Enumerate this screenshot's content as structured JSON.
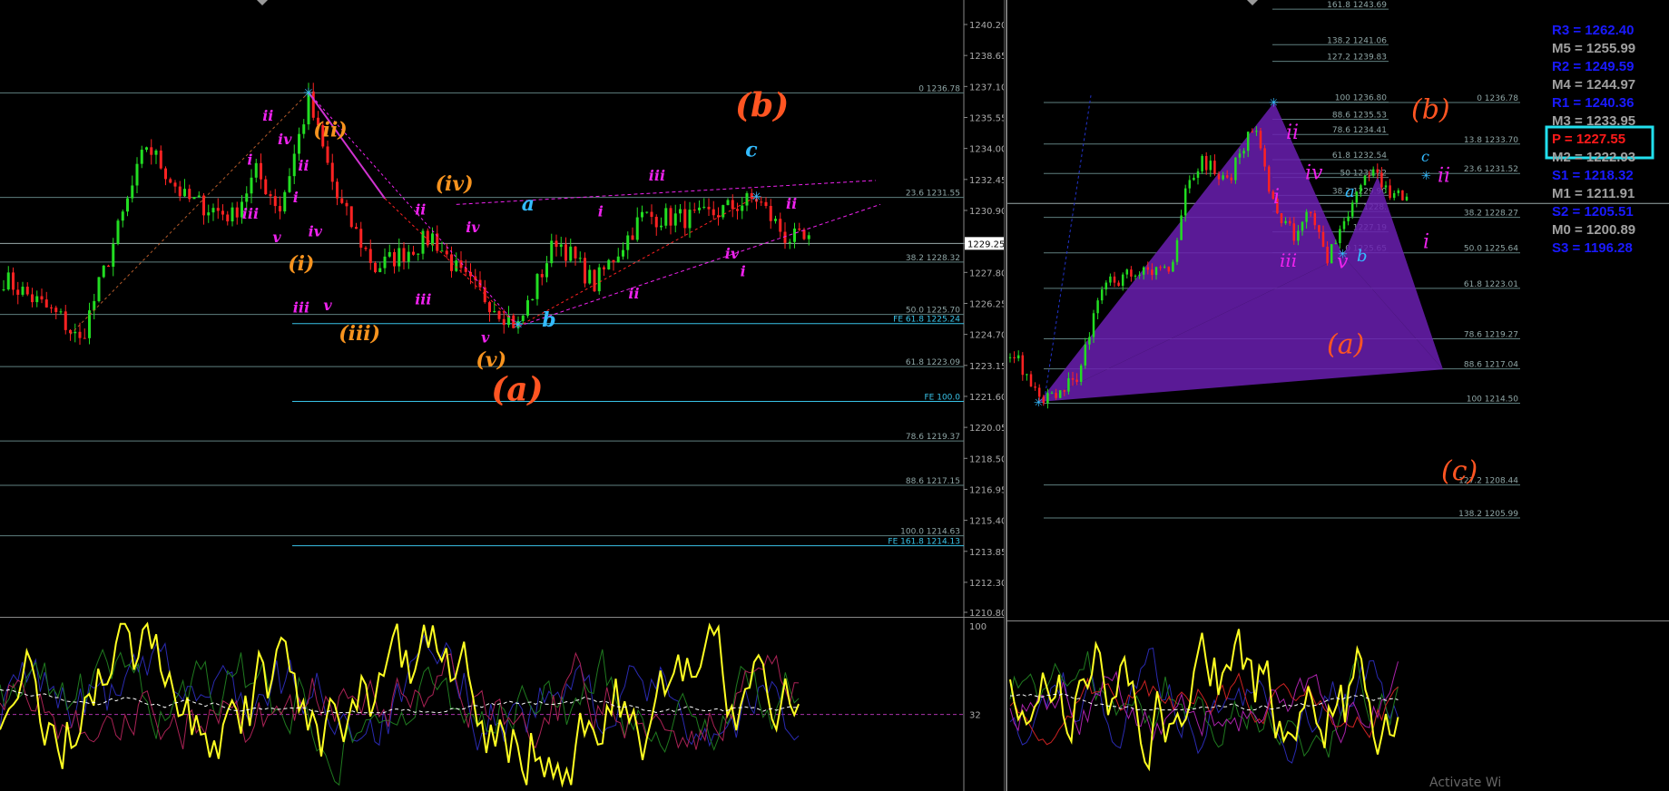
{
  "colors": {
    "bull": "#22dd22",
    "bear": "#ff2222",
    "fib": "#5f7f7f",
    "fe": "#39c3e8",
    "magenta": "#ee22ee",
    "orange": "#f7931e",
    "orange_red": "#ff5522",
    "cyan": "#33bbff",
    "yellow": "#ffff22",
    "purple_fill": "#6a1fb0",
    "wave_text": "#ff55ee"
  },
  "chart_data": [
    {
      "type": "candlestick",
      "panel": "left-main",
      "ylim": [
        1210.0,
        1241.0
      ],
      "ticks": [
        "1240.20",
        "1238.65",
        "1237.10",
        "1235.55",
        "1234.00",
        "1232.45",
        "1230.90",
        "1229.25",
        "1227.80",
        "1226.25",
        "1224.70",
        "1223.15",
        "1221.60",
        "1220.05",
        "1218.50",
        "1216.95",
        "1215.40",
        "1213.85",
        "1212.30",
        "1210.80"
      ],
      "current_price": "1229.25",
      "fib_levels": [
        {
          "label": "0 1236.78",
          "y": 1236.78
        },
        {
          "label": "23.6 1231.55",
          "y": 1231.55
        },
        {
          "label": "38.2 1228.32",
          "y": 1228.32
        },
        {
          "label": "50.0 1225.70",
          "y": 1225.7
        },
        {
          "label": "61.8 1223.09",
          "y": 1223.09
        },
        {
          "label": "78.6 1219.37",
          "y": 1219.37
        },
        {
          "label": "88.6 1217.15",
          "y": 1217.15
        },
        {
          "label": "100.0 1214.63",
          "y": 1214.63
        }
      ],
      "fe_levels": [
        {
          "label": "FE 61.8 1225.24",
          "y": 1225.24
        },
        {
          "label": "FE 100.0",
          "y": 1221.35
        },
        {
          "label": "FE 161.8 1214.13",
          "y": 1214.13
        }
      ],
      "waves": [
        {
          "t": "(b)",
          "x": 0.0,
          "y": 1235.6,
          "c": "orange_red",
          "s": 36
        },
        {
          "t": "(a)",
          "x": -0.48,
          "y": 1221.4,
          "c": "orange_red",
          "s": 36
        },
        {
          "t": "(ii)",
          "x": -0.83,
          "y": 1234.6,
          "c": "orange",
          "s": 22
        },
        {
          "t": "(iv)",
          "x": -0.59,
          "y": 1231.9,
          "c": "orange",
          "s": 22
        },
        {
          "t": "(i)",
          "x": -0.88,
          "y": 1227.9,
          "c": "orange",
          "s": 22
        },
        {
          "t": "(iii)",
          "x": -0.78,
          "y": 1224.4,
          "c": "orange",
          "s": 22
        },
        {
          "t": "(v)",
          "x": -0.51,
          "y": 1223.1,
          "c": "orange",
          "s": 22
        },
        {
          "t": "a",
          "x": -0.42,
          "y": 1230.9,
          "c": "cyan",
          "s": 22
        },
        {
          "t": "b",
          "x": -0.38,
          "y": 1225.1,
          "c": "cyan",
          "s": 22
        },
        {
          "t": "c",
          "x": 0.02,
          "y": 1233.6,
          "c": "cyan",
          "s": 22
        },
        {
          "t": "ii",
          "x": -0.93,
          "y": 1235.4,
          "c": "magenta",
          "s": 16
        },
        {
          "t": "iv",
          "x": -0.9,
          "y": 1234.2,
          "c": "magenta",
          "s": 16
        },
        {
          "t": "ii",
          "x": -0.86,
          "y": 1232.9,
          "c": "magenta",
          "s": 16
        },
        {
          "t": "i",
          "x": -0.96,
          "y": 1233.2,
          "c": "magenta",
          "s": 16
        },
        {
          "t": "iii",
          "x": -0.97,
          "y": 1230.5,
          "c": "magenta",
          "s": 16
        },
        {
          "t": "i",
          "x": -0.87,
          "y": 1231.3,
          "c": "magenta",
          "s": 16
        },
        {
          "t": "v",
          "x": -0.91,
          "y": 1229.3,
          "c": "magenta",
          "s": 16
        },
        {
          "t": "iv",
          "x": -0.84,
          "y": 1229.6,
          "c": "magenta",
          "s": 16
        },
        {
          "t": "iii",
          "x": -0.87,
          "y": 1225.8,
          "c": "magenta",
          "s": 16
        },
        {
          "t": "v",
          "x": -0.81,
          "y": 1225.9,
          "c": "magenta",
          "s": 16
        },
        {
          "t": "ii",
          "x": -0.63,
          "y": 1230.7,
          "c": "magenta",
          "s": 16
        },
        {
          "t": "iv",
          "x": -0.53,
          "y": 1229.8,
          "c": "magenta",
          "s": 16
        },
        {
          "t": "iii",
          "x": -0.63,
          "y": 1226.2,
          "c": "magenta",
          "s": 16
        },
        {
          "t": "v",
          "x": -0.5,
          "y": 1224.3,
          "c": "magenta",
          "s": 16
        },
        {
          "t": "iii",
          "x": -0.17,
          "y": 1232.4,
          "c": "magenta",
          "s": 16
        },
        {
          "t": "i",
          "x": -0.27,
          "y": 1230.6,
          "c": "magenta",
          "s": 16
        },
        {
          "t": "ii",
          "x": -0.21,
          "y": 1226.5,
          "c": "magenta",
          "s": 16
        },
        {
          "t": "iv",
          "x": -0.02,
          "y": 1228.5,
          "c": "magenta",
          "s": 16
        },
        {
          "t": "i",
          "x": 0.01,
          "y": 1227.6,
          "c": "magenta",
          "s": 16
        },
        {
          "t": "ii",
          "x": 0.1,
          "y": 1231.0,
          "c": "magenta",
          "s": 16
        }
      ]
    },
    {
      "type": "candlestick",
      "panel": "right-main",
      "ylim": [
        1202.5,
        1244.5
      ],
      "fib_levels": [
        {
          "label": "161.8 1243.69",
          "y": 1243.69
        },
        {
          "label": "138.2 1241.06",
          "y": 1241.06
        },
        {
          "label": "127.2 1239.83",
          "y": 1239.83
        },
        {
          "label": "100 1236.80",
          "y": 1236.8
        },
        {
          "label": "88.6 1235.53",
          "y": 1235.53
        },
        {
          "label": "78.6 1234.41",
          "y": 1234.41
        },
        {
          "label": "61.8 1232.54",
          "y": 1232.54
        },
        {
          "label": "50 1231.22",
          "y": 1231.22
        },
        {
          "label": "38.2 1229.90",
          "y": 1229.9
        },
        {
          "label": "1228.",
          "y": 1228.7
        },
        {
          "label": "1227.19",
          "y": 1227.19
        },
        {
          "label": "0 1225.65",
          "y": 1225.65
        },
        {
          "label": "0 1236.78",
          "y": 1236.78
        },
        {
          "label": "13.8 1233.70",
          "y": 1233.7
        },
        {
          "label": "23.6 1231.52",
          "y": 1231.52
        },
        {
          "label": "38.2 1228.27",
          "y": 1228.27
        },
        {
          "label": "50.0 1225.64",
          "y": 1225.64
        },
        {
          "label": "61.8 1223.01",
          "y": 1223.01
        },
        {
          "label": "78.6 1219.27",
          "y": 1219.27
        },
        {
          "label": "88.6 1217.04",
          "y": 1217.04
        },
        {
          "label": "100 1214.50",
          "y": 1214.5
        },
        {
          "label": "127.2 1208.44",
          "y": 1208.44
        },
        {
          "label": "138.2 1205.99",
          "y": 1205.99
        }
      ],
      "pivots": [
        {
          "name": "R3",
          "value": "1262.40",
          "color": "#1a1aff"
        },
        {
          "name": "M5",
          "value": "1255.99",
          "color": "#a0a0a0"
        },
        {
          "name": "R2",
          "value": "1249.59",
          "color": "#1a1aff"
        },
        {
          "name": "M4",
          "value": "1244.97",
          "color": "#a0a0a0"
        },
        {
          "name": "R1",
          "value": "1240.36",
          "color": "#1a1aff"
        },
        {
          "name": "M3",
          "value": "1233.95",
          "color": "#a0a0a0"
        },
        {
          "name": "P",
          "value": "1227.55",
          "color": "#ff1a1a"
        },
        {
          "name": "M2",
          "value": "1222.93",
          "color": "#a0a0a0"
        },
        {
          "name": "S1",
          "value": "1218.32",
          "color": "#1a1aff"
        },
        {
          "name": "M1",
          "value": "1211.91",
          "color": "#a0a0a0"
        },
        {
          "name": "S2",
          "value": "1205.51",
          "color": "#1a1aff"
        },
        {
          "name": "M0",
          "value": "1200.89",
          "color": "#a0a0a0"
        },
        {
          "name": "S3",
          "value": "1196.28",
          "color": "#1a1aff"
        }
      ],
      "waves": [
        {
          "t": "(b)",
          "c": "orange_red"
        },
        {
          "t": "(a)",
          "c": "orange_red"
        },
        {
          "t": "(c)",
          "c": "orange_red"
        },
        {
          "t": "ii",
          "c": "magenta"
        },
        {
          "t": "iv",
          "c": "magenta"
        },
        {
          "t": "i",
          "c": "magenta"
        },
        {
          "t": "iii",
          "c": "magenta"
        },
        {
          "t": "v",
          "c": "magenta"
        },
        {
          "t": "a",
          "c": "cyan"
        },
        {
          "t": "b",
          "c": "cyan"
        },
        {
          "t": "c",
          "c": "cyan"
        },
        {
          "t": "ii",
          "c": "magenta"
        },
        {
          "t": "i",
          "c": "magenta"
        }
      ]
    },
    {
      "type": "line",
      "panel": "left-osc",
      "ylim": [
        0,
        100
      ],
      "ticks": [
        "100",
        "32"
      ],
      "level": 32
    },
    {
      "type": "line",
      "panel": "right-osc",
      "ylim": [
        0,
        100
      ]
    }
  ],
  "footer_text": "Activate Wi"
}
